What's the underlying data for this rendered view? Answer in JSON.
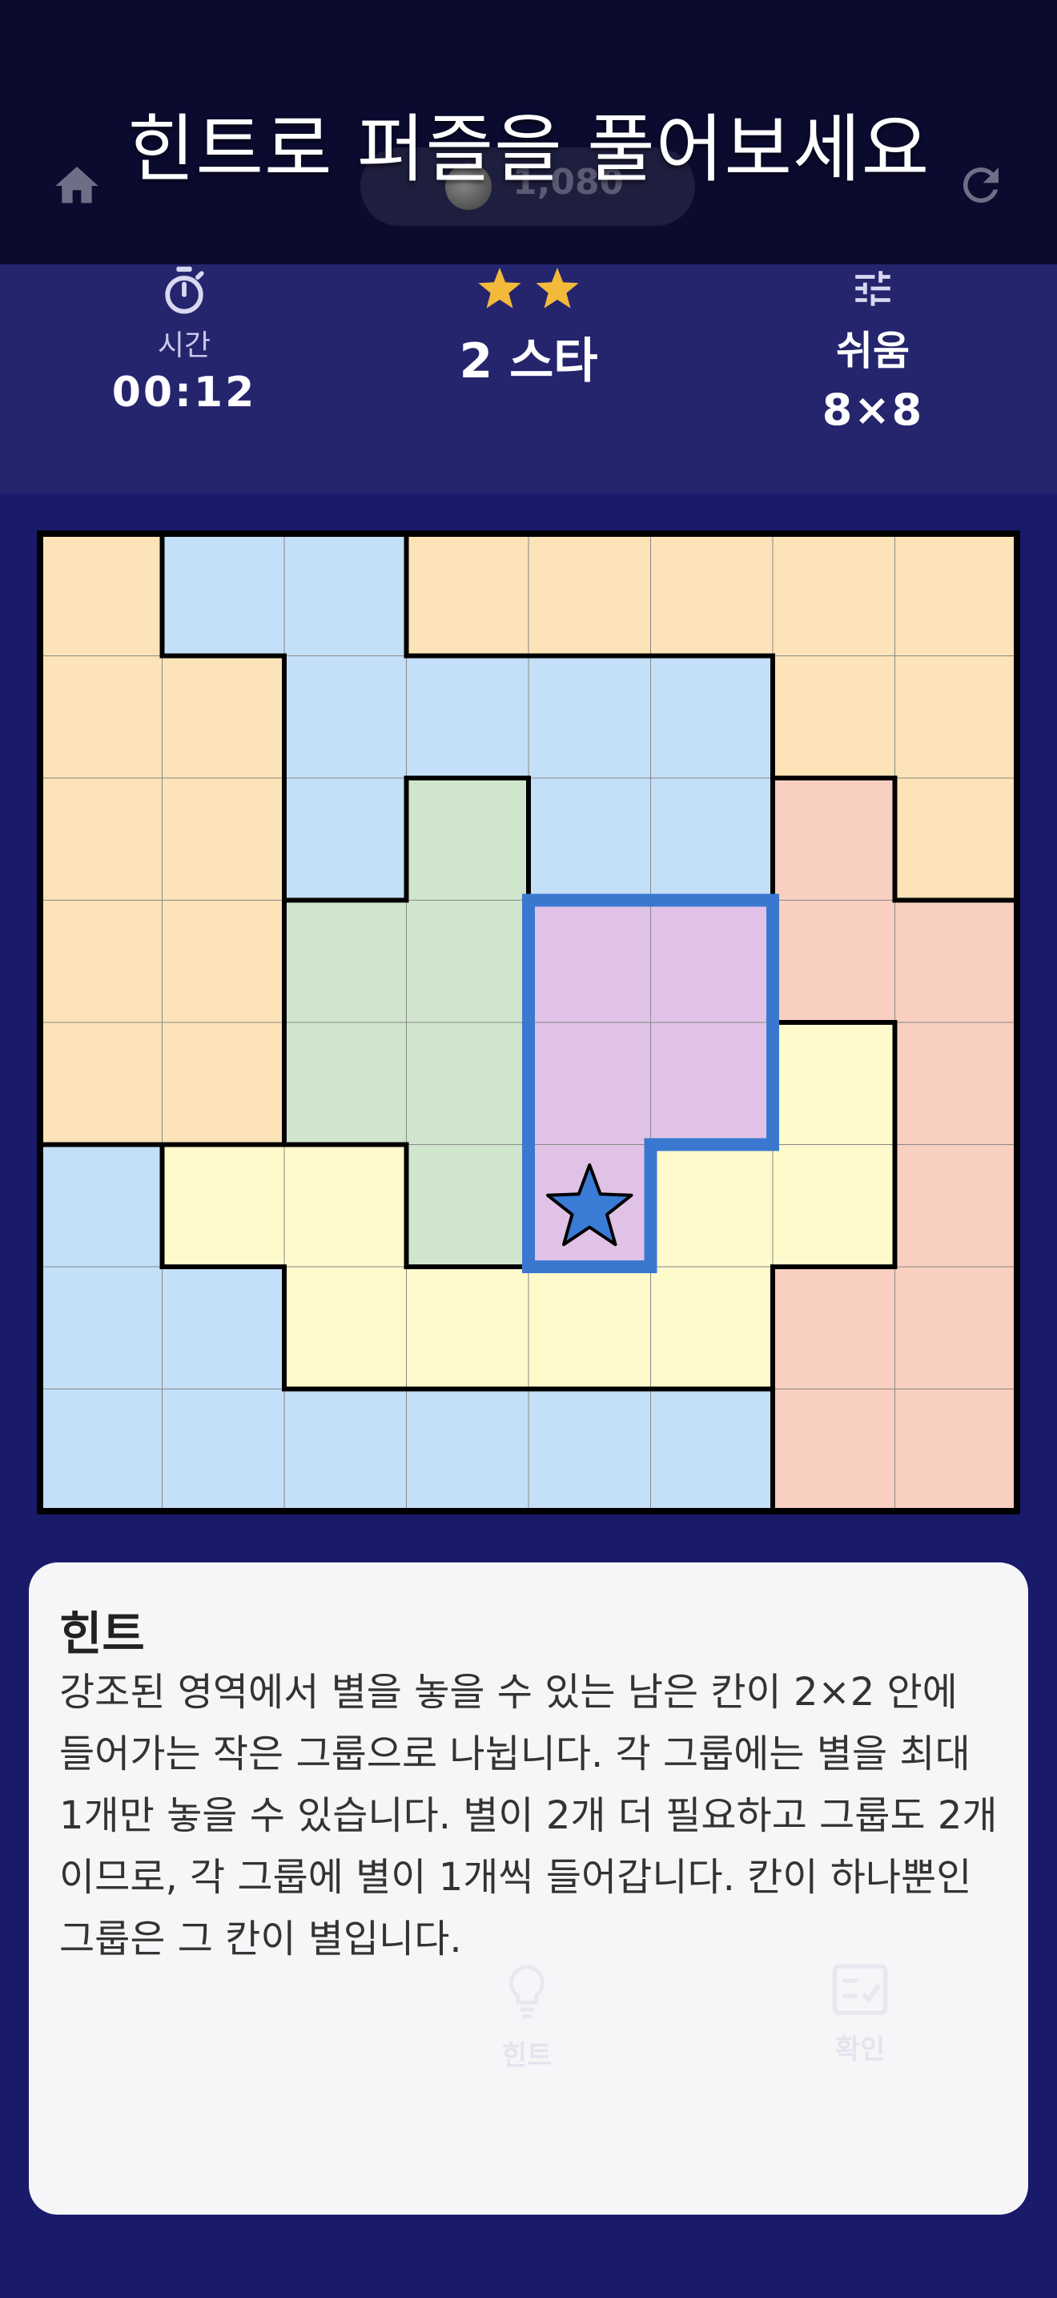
{
  "banner": "힌트로 퍼즐을 풀어보세요",
  "header": {
    "coins": "1,080",
    "icons": {
      "home": "home-icon",
      "refresh": "refresh-icon",
      "coin": "coin-icon"
    }
  },
  "stats": {
    "time_label": "시간",
    "time_value": "00:12",
    "stars_count": 2,
    "stars_label": "2 스타",
    "difficulty": "쉬움",
    "size": "8×8",
    "icons": {
      "timer": "timer-icon",
      "difficulty": "tune-icon",
      "star": "star-icon"
    },
    "star_color": "#f2b93b"
  },
  "board": {
    "rows": 8,
    "cols": 8,
    "regions": [
      [
        "O",
        "B",
        "B",
        "O",
        "O",
        "O",
        "O",
        "O"
      ],
      [
        "O",
        "O",
        "B",
        "B",
        "B",
        "B",
        "O",
        "O"
      ],
      [
        "O",
        "O",
        "B",
        "G",
        "B",
        "B",
        "R",
        "O"
      ],
      [
        "O",
        "O",
        "G",
        "G",
        "P",
        "P",
        "R",
        "R"
      ],
      [
        "O",
        "O",
        "G",
        "G",
        "P",
        "P",
        "Y",
        "R"
      ],
      [
        "C",
        "Y",
        "Y",
        "G",
        "P",
        "Y",
        "Y",
        "R"
      ],
      [
        "C",
        "C",
        "Y",
        "Y",
        "Y",
        "Y",
        "R",
        "R"
      ],
      [
        "C",
        "C",
        "C",
        "C",
        "C",
        "C",
        "R",
        "R"
      ]
    ],
    "colors": {
      "O": "#fde3b8",
      "B": "#c4dff8",
      "C": "#c4dff8",
      "G": "#cfe6cc",
      "R": "#f8cfc0",
      "Y": "#fffacc",
      "P": "#dfc2e6"
    },
    "highlight_region": "P",
    "highlight_color": "#3a78d0",
    "stars": [
      {
        "row": 5,
        "col": 4
      }
    ],
    "placed_star_color": "#3a7bd5"
  },
  "hint": {
    "title": "힌트",
    "text": "강조된 영역에서 별을 놓을 수 있는 남은 칸이 2×2 안에 들어가는 작은 그룹으로 나뉩니다. 각 그룹에는 별을 최대 1개만 놓을 수 있습니다. 별이 2개 더 필요하고 그룹도 2개이므로, 각 그룹에 별이 1개씩 들어갑니다. 칸이 하나뿐인 그룹은 그 칸이 별입니다."
  },
  "bottom": {
    "hint_label": "힌트",
    "check_label": "확인",
    "icons": {
      "hint": "lightbulb-icon",
      "check": "check-icon"
    }
  }
}
